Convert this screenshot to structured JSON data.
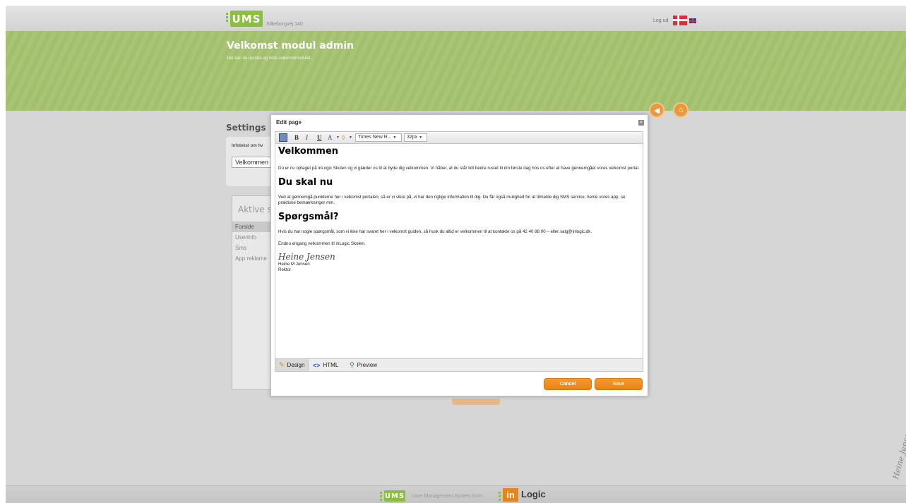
{
  "header": {
    "logo": "UMS",
    "address": "Silkeborgvej 140",
    "logout": "Log ud"
  },
  "banner": {
    "title": "Velkomst modul admin",
    "subtitle": "Her kan du oprette og rette velkomstmodulet..."
  },
  "settings": {
    "title": "Settings",
    "infotekst_label": "Infotekst om hv",
    "infotekst_value": "Velkommen"
  },
  "pages": {
    "title": "Aktive side",
    "items": [
      "Forside",
      "UserInfo",
      "Sms",
      "App reklame"
    ]
  },
  "modal": {
    "title": "Edit page",
    "close": "✕",
    "toolbar": {
      "bold": "B",
      "italic": "I",
      "underline": "U",
      "font_color": "A",
      "font": "Times New R...",
      "size": "32px"
    },
    "content": {
      "heading1": "Velkommen",
      "para1": "Du er nu optaget på inLogic Skolen og vi glæder os til at byde dig velkommen. Vi håber, at du står lidt bedre rustet til din første dag hos os efter at have gennemgået vores velkomst portal.",
      "heading2": "Du skal nu",
      "para2": "Ved at gennemgå punkterne her i velkomst portalen, så er vi sikre på, vi har den rigtige information til dig. Du får også mulighed for at tilmelde dig SMS service, hente vores app, se praktiske bemærkninger mm.",
      "heading3": "Spørgsmål?",
      "para3": "Hvis du har nogle spørgsmål, som vi ikke har svaret her i velkomst guiden, så husk du altid er velkommen til at kontakte os på 42 40 88 00 – eller salg@inlogic.dk.",
      "para4": "Endnu engang velkommen til inLogic Skolen.",
      "signature": "Heine Jensen",
      "sig_name": "Heine M Jensen",
      "sig_title": "Rektor"
    },
    "tabs": {
      "design": "Design",
      "html": "HTML",
      "preview": "Preview"
    },
    "buttons": {
      "cancel": "Cancel",
      "save": "Save"
    }
  },
  "footer": {
    "logo": "UMS",
    "text": "User Management System from",
    "brand_in": "in",
    "brand_logic": "Logic",
    "side_signature": "Heine Jensen"
  },
  "colors": {
    "banner_green": "#a8c475",
    "ums_green": "#8bbf3f",
    "accent_orange": "#f0902a",
    "background_gray": "#d6d6d6"
  }
}
